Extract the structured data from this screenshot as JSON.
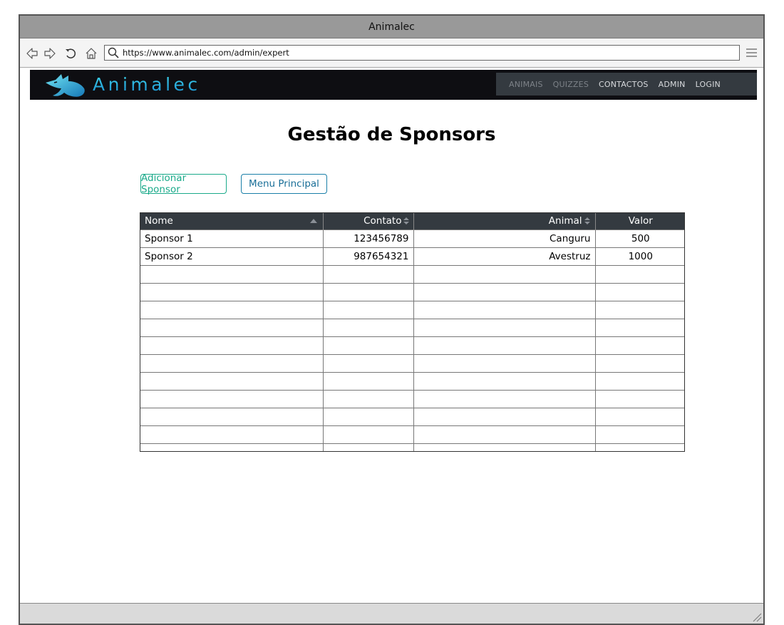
{
  "window": {
    "title": "Animalec"
  },
  "browser": {
    "url": "https://www.animalec.com/admin/expert"
  },
  "site": {
    "brand": "Animalec",
    "menu": [
      {
        "label": "ANIMAIS",
        "style": "dim"
      },
      {
        "label": "QUIZZES",
        "style": "dim"
      },
      {
        "label": "CONTACTOS",
        "style": "bright"
      },
      {
        "label": "ADMIN",
        "style": "bright"
      },
      {
        "label": "LOGIN",
        "style": "bright"
      }
    ]
  },
  "page": {
    "title": "Gestão de Sponsors",
    "add_button": "Adicionar Sponsor",
    "menu_button": "Menu Principal"
  },
  "table": {
    "headers": [
      "Nome",
      "Contato",
      "Animal",
      "Valor"
    ],
    "rows": [
      [
        "Sponsor 1",
        "123456789",
        "Canguru",
        "500"
      ],
      [
        "Sponsor 2",
        "987654321",
        "Avestruz",
        "1000"
      ]
    ],
    "empty_rows": 11
  },
  "colors": {
    "nav_bg": "#0e0e12",
    "menu_bg": "#343a40",
    "brand": "#21b7da",
    "add_button": "#1aaa8a",
    "menu_button": "#1a6f98",
    "table_header": "#343a40"
  }
}
